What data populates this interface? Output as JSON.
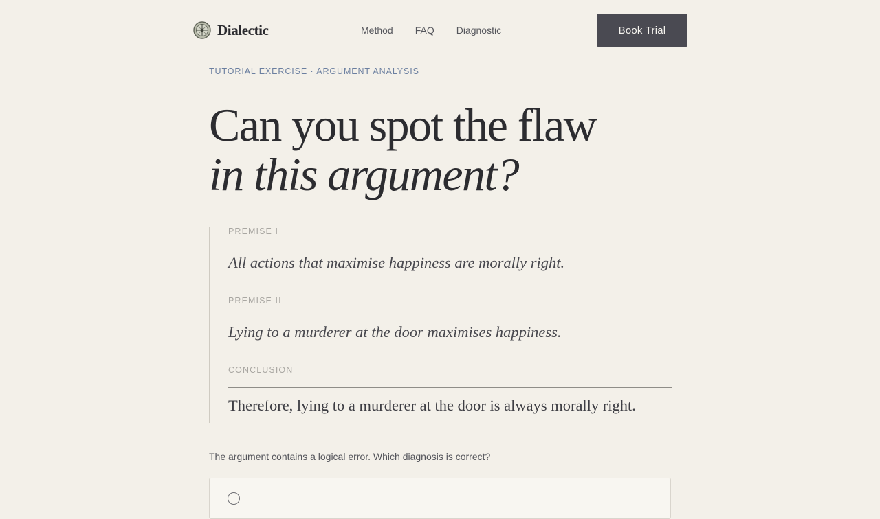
{
  "brand": {
    "name": "Dialectic",
    "logo_icon": "compass-seal-icon"
  },
  "nav": {
    "links": [
      "Method",
      "FAQ",
      "Diagnostic"
    ],
    "cta_label": "Book Trial"
  },
  "exercise": {
    "eyebrow": "TUTORIAL EXERCISE · ARGUMENT ANALYSIS",
    "headline_line1": "Can you spot the flaw",
    "headline_line2": "in this argument?",
    "premise_1_label": "PREMISE I",
    "premise_1_text": "All actions that maximise happiness are morally right.",
    "premise_2_label": "PREMISE II",
    "premise_2_text": "Lying to a murderer at the door maximises happiness.",
    "conclusion_label": "CONCLUSION",
    "conclusion_text": "Therefore, lying to a murderer at the door is always morally right.",
    "question": "The argument contains a logical error. Which diagnosis is correct?"
  },
  "colors": {
    "page_background": "#f3f0e9",
    "cta_background": "#4a4a52",
    "eyebrow": "#6b7fa0",
    "text_primary": "#2c2c30"
  }
}
